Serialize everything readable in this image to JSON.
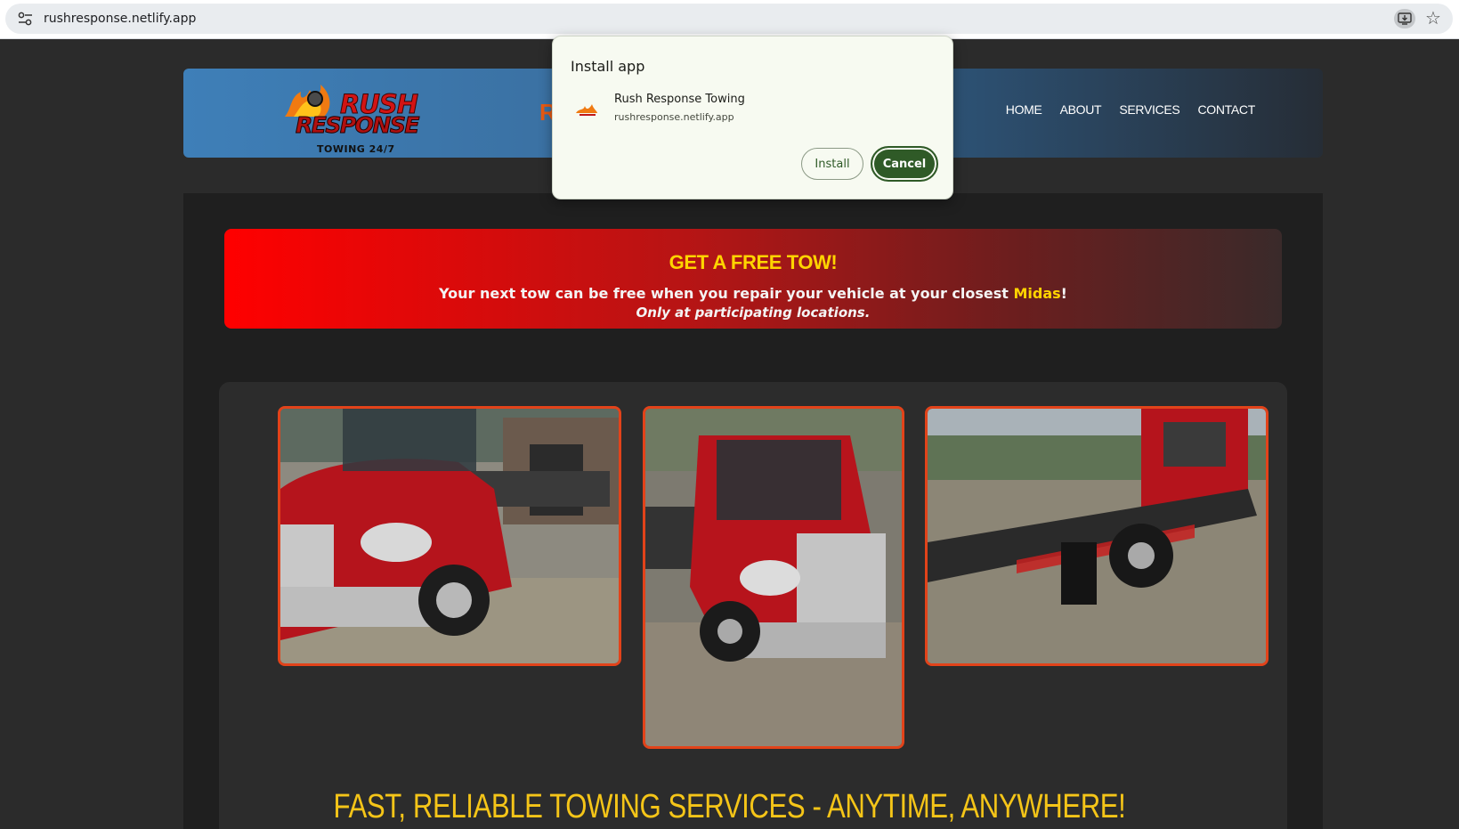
{
  "browser": {
    "url": "rushresponse.netlify.app",
    "icons": [
      "site-info-icon",
      "install-app-icon",
      "bookmark-star-icon"
    ]
  },
  "header": {
    "logo": {
      "line1": "RUSH",
      "line2": "RESPONSE",
      "tagline": "TOWING 24/7"
    },
    "brand_partial": "R",
    "nav": [
      "HOME",
      "ABOUT",
      "SERVICES",
      "CONTACT"
    ]
  },
  "promo": {
    "title": "GET A FREE TOW!",
    "line1_before": "Your next tow can be free when you repair your vehicle at your closest ",
    "line1_highlight": "Midas",
    "line1_after": "!",
    "line2": "Only at participating locations."
  },
  "gallery": {
    "photos": [
      "red-tow-truck-front-left",
      "red-tow-truck-front-right",
      "tow-truck-flatbed-side"
    ]
  },
  "tagline": "FAST, RELIABLE TOWING SERVICES - ANYTIME, ANYWHERE!",
  "dialog": {
    "title": "Install app",
    "app_name": "Rush Response Towing",
    "app_url": "rushresponse.netlify.app",
    "install_label": "Install",
    "cancel_label": "Cancel"
  },
  "colors": {
    "accent_yellow": "#ffd400",
    "photo_border": "#e2431a",
    "dialog_button": "#2f5a27"
  }
}
